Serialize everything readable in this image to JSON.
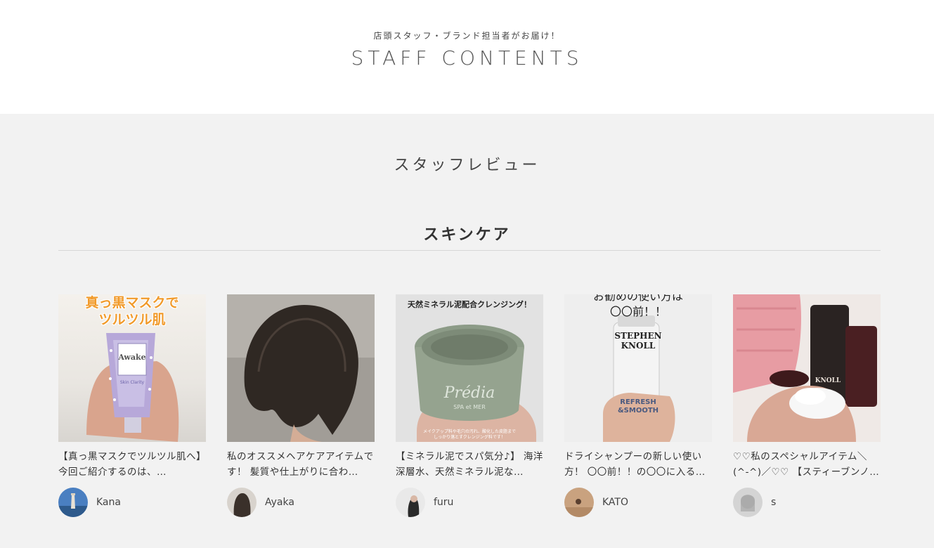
{
  "header": {
    "subtitle": "店頭スタッフ・ブランド担当者がお届け！",
    "title": "STAFF CONTENTS"
  },
  "main": {
    "section_title": "スタッフレビュー",
    "category_title": "スキンケア",
    "cards": [
      {
        "image_text": "真っ黒マスクで\nツルツル肌",
        "product_text": "Awake",
        "product_subtext": "Skin Clarity",
        "description": "【真っ黒マスクでツルツル肌へ】　今回ご紹介するのは、…",
        "username": "Kana"
      },
      {
        "description": "私のオススメヘアケアアイテムです！ 髪質や仕上がりに合わ…",
        "username": "Ayaka"
      },
      {
        "image_text": "天然ミネラル泥配合クレンジング！",
        "product_text": "Prédia",
        "product_subtext": "SPA et MER",
        "image_caption": "メイクアップ料や毛穴の汚れ、酸化した皮脂まで\nしっかり落とすクレンジング料です！",
        "description": "【ミネラル泥でスパ気分♪】 海洋深層水、天然ミネラル泥な…",
        "username": "furu"
      },
      {
        "image_text": "お勧めの使い方は\n〇〇前！！",
        "product_text": "STEPHEN\nKNOLL",
        "product_subtext": "REFRESH\n&SMOOTH",
        "description": "ドライシャンプーの新しい使い方！ 〇〇前！！の〇〇に入る…",
        "username": "KATO"
      },
      {
        "product_text": "KNOLL",
        "description": "♡♡私のスペシャルアイテム＼(^-^)／♡♡ 【スティーブンノ…",
        "username": "s"
      }
    ]
  },
  "colors": {
    "background": "#f2f2f2",
    "header_bg": "#ffffff",
    "text": "#333333",
    "divider": "#d7d7d7"
  }
}
